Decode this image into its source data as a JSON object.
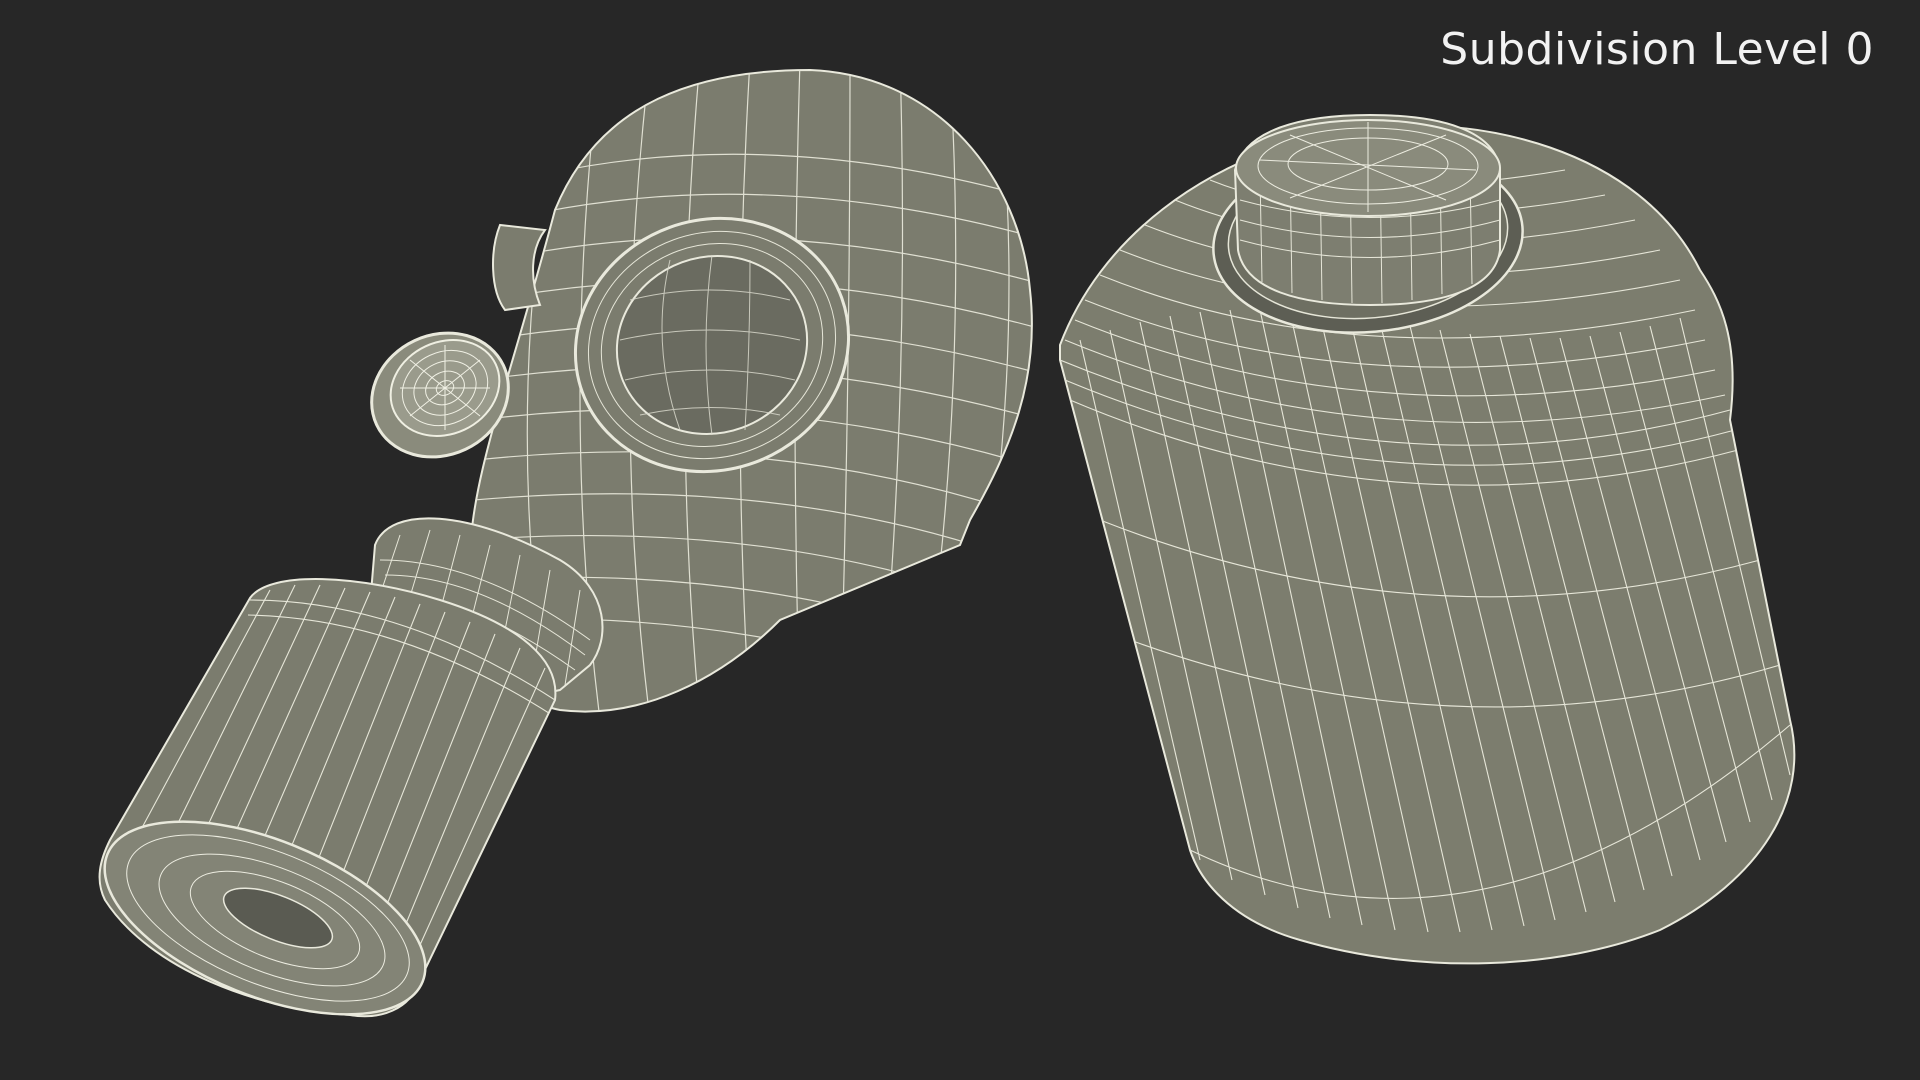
{
  "viewport": {
    "label": "Subdivision Level 0",
    "background_color": "#272727",
    "mesh_fill_color": "#7c7d6e",
    "wire_color": "#e9e9dc"
  },
  "objects": [
    {
      "name": "gas-mask"
    },
    {
      "name": "filter-canister"
    }
  ]
}
